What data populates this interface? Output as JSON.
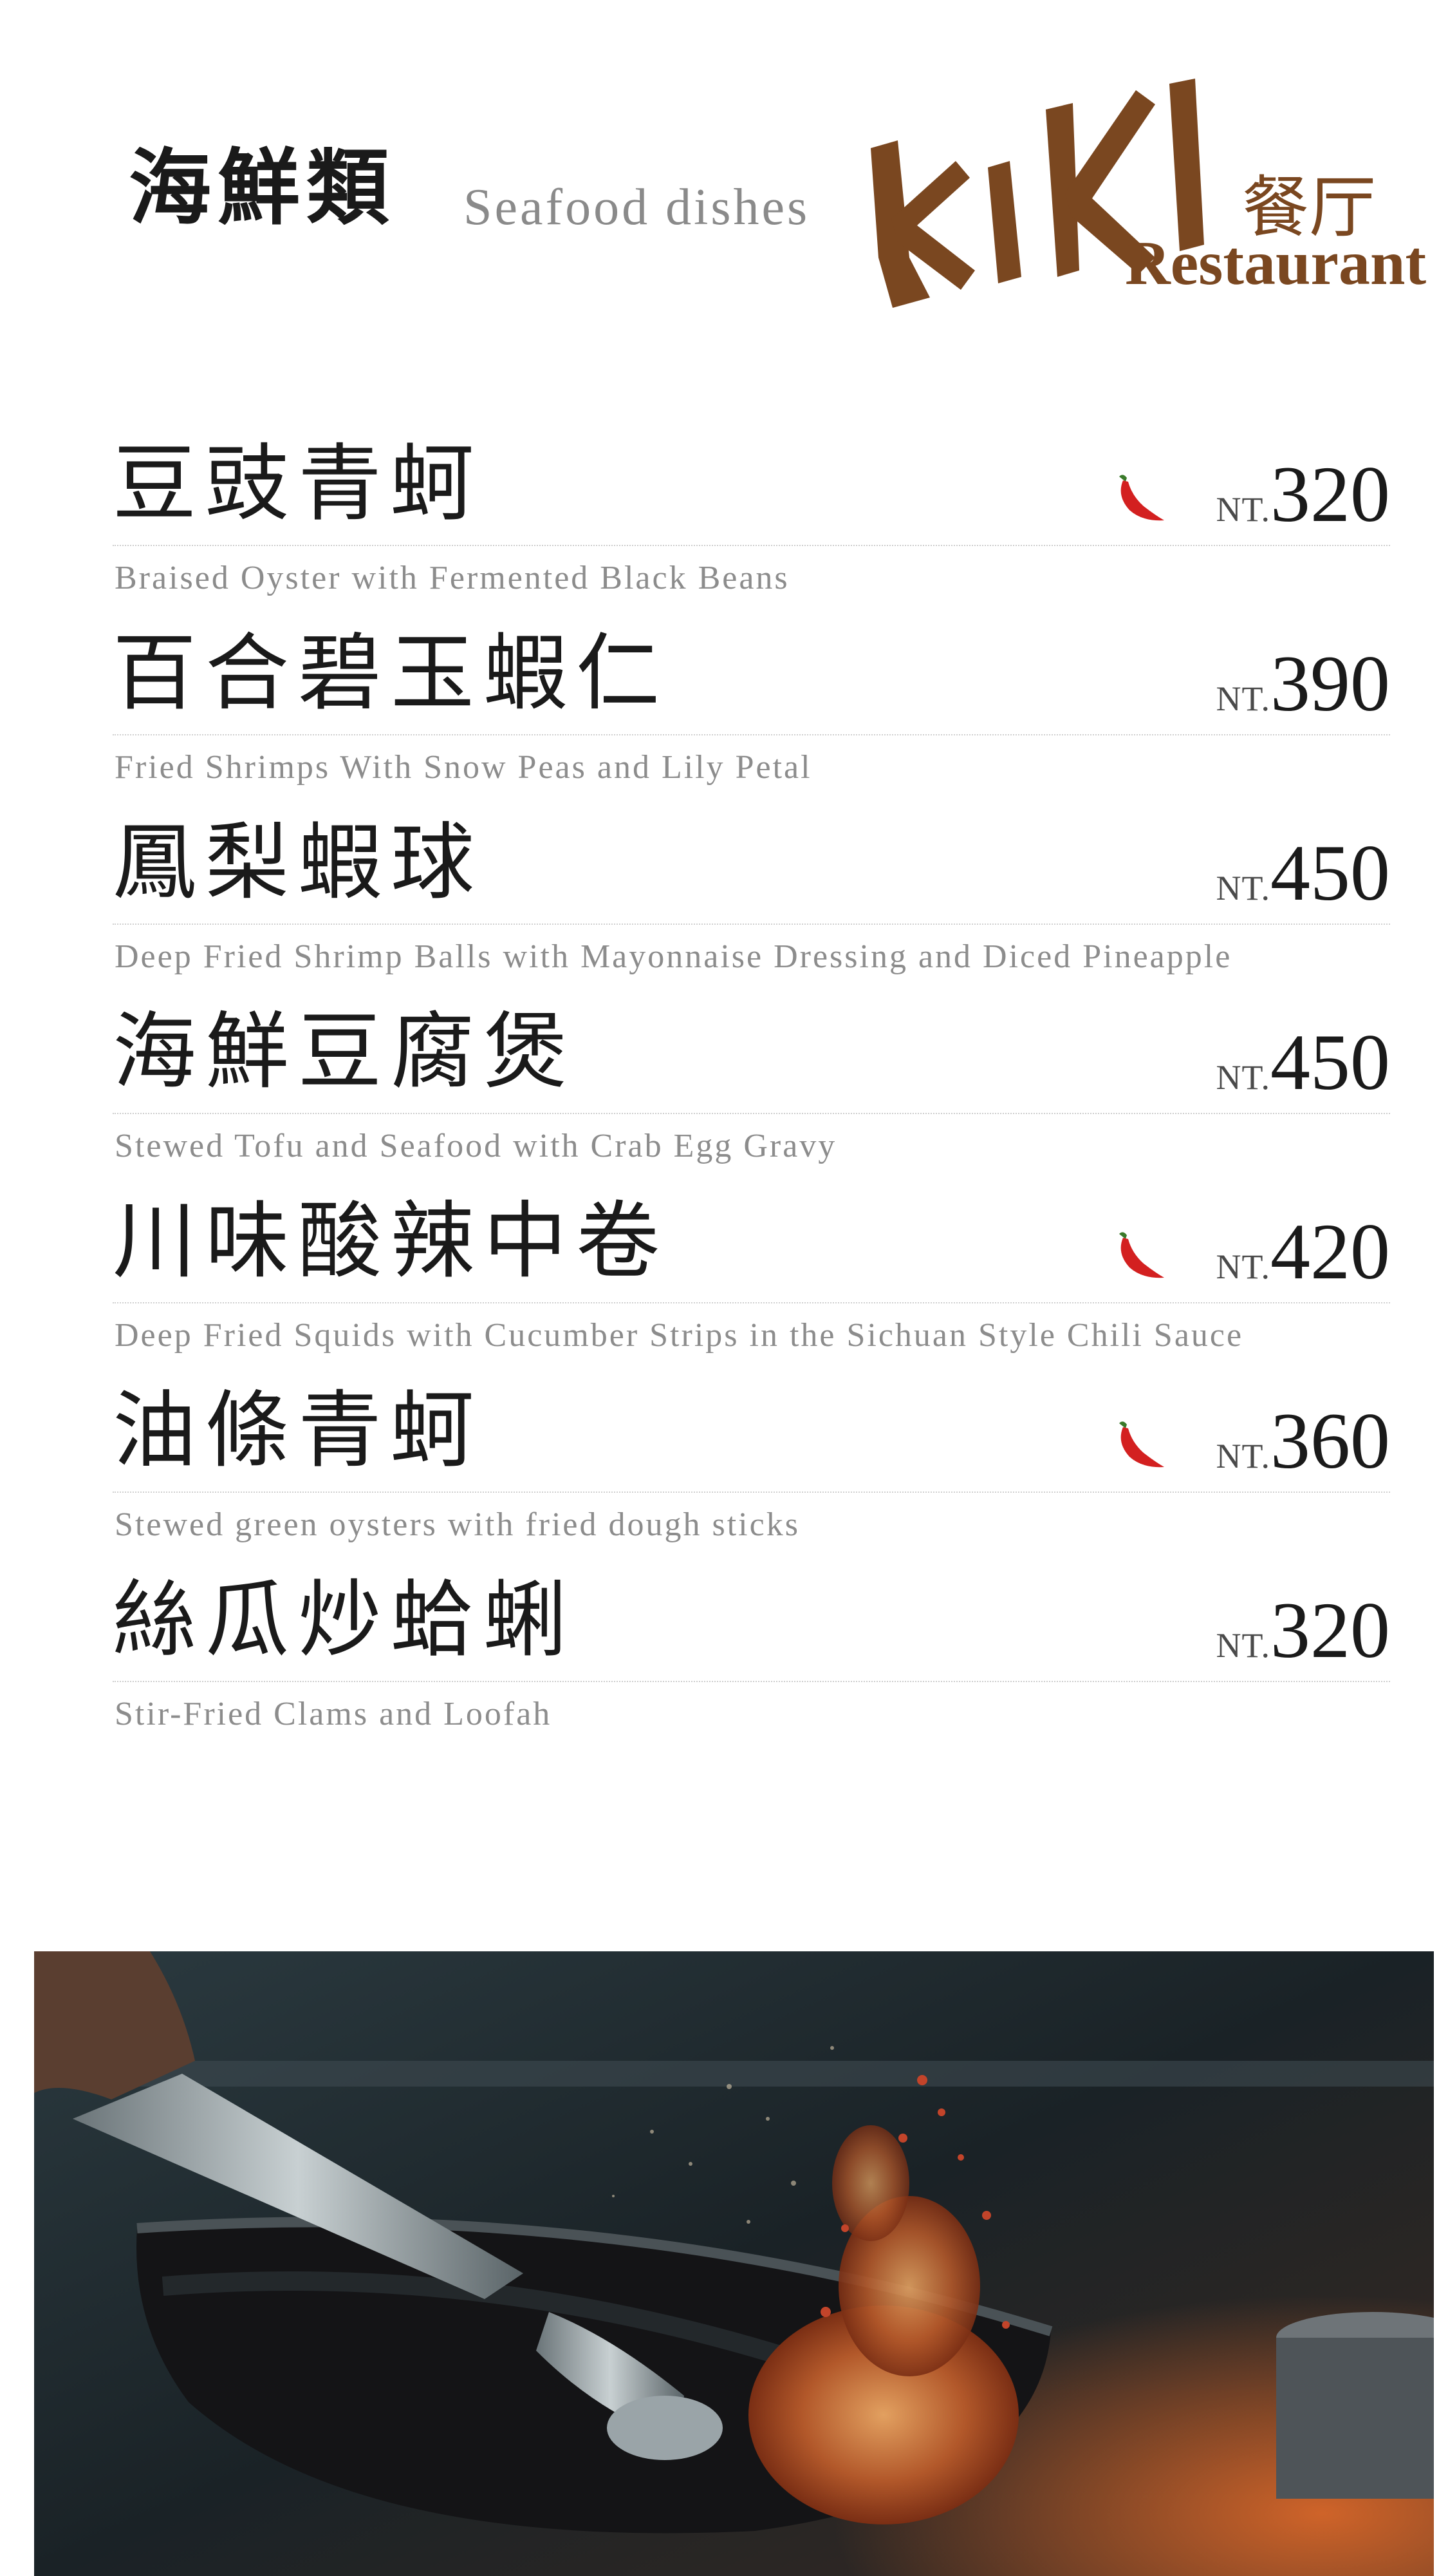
{
  "header": {
    "title_zh": "海鮮類",
    "title_en": "Seafood dishes"
  },
  "logo": {
    "wordmark": "KIKI",
    "name_zh": "餐厅",
    "name_en": "Restaurant",
    "color": "#7a4720"
  },
  "currency": "NT.",
  "items": [
    {
      "name_zh": "豆豉青蚵",
      "name_en": "Braised Oyster with Fermented Black Beans",
      "price": "320",
      "spicy": true
    },
    {
      "name_zh": "百合碧玉蝦仁",
      "name_en": "Fried Shrimps With Snow Peas and Lily Petal",
      "price": "390",
      "spicy": false
    },
    {
      "name_zh": "鳳梨蝦球",
      "name_en": "Deep Fried Shrimp Balls with Mayonnaise Dressing and Diced Pineapple",
      "price": "450",
      "spicy": false
    },
    {
      "name_zh": "海鮮豆腐煲",
      "name_en": "Stewed Tofu and Seafood with Crab Egg Gravy",
      "price": "450",
      "spicy": false
    },
    {
      "name_zh": "川味酸辣中卷",
      "name_en": "Deep Fried Squids with Cucumber Strips in the Sichuan Style Chili Sauce",
      "price": "420",
      "spicy": true
    },
    {
      "name_zh": "油條青蚵",
      "name_en": "Stewed green oysters with fried dough sticks",
      "price": "360",
      "spicy": true
    },
    {
      "name_zh": "絲瓜炒蛤蜊",
      "name_en": "Stir-Fried Clams and Loofah",
      "price": "320",
      "spicy": false
    }
  ],
  "icons": {
    "spicy": "chili-pepper-icon"
  },
  "colors": {
    "chili": "#d32020",
    "accent_brown": "#7a4720"
  }
}
